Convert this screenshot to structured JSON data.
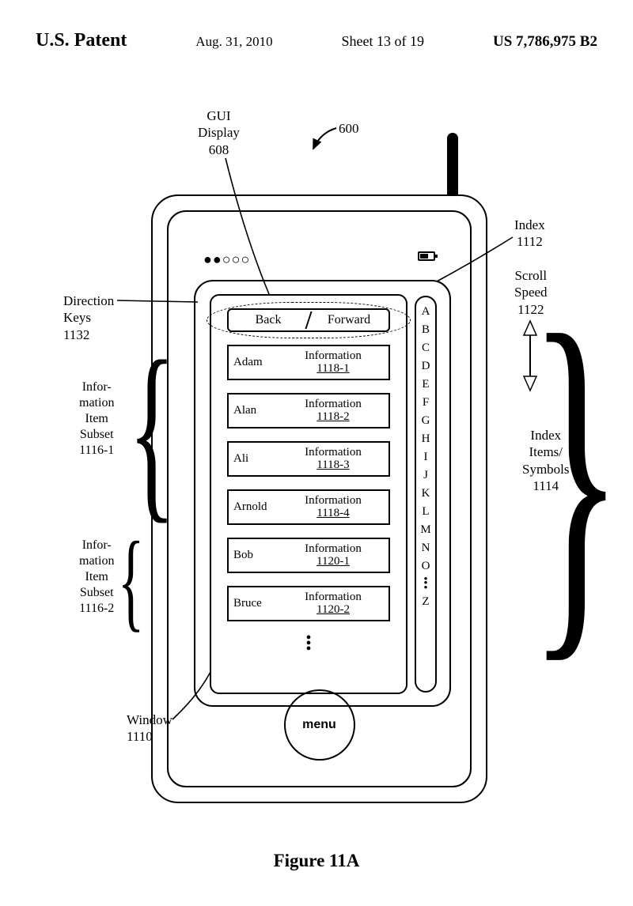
{
  "header": {
    "title": "U.S. Patent",
    "date": "Aug. 31, 2010",
    "sheet": "Sheet 13 of 19",
    "patno": "US 7,786,975 B2"
  },
  "labels": {
    "gui_display": "GUI\nDisplay\n608",
    "ref600": "600",
    "direction_keys": "Direction\nKeys\n1132",
    "index": "Index\n1112",
    "scroll_speed": "Scroll\nSpeed\n1122",
    "subset1": "Infor-\nmation\nItem\nSubset\n1116-1",
    "subset2": "Infor-\nmation\nItem\nSubset\n1116-2",
    "index_items": "Index\nItems/\nSymbols\n1114",
    "window": "Window\n1110",
    "figure": "Figure 11A"
  },
  "status": {
    "dots": "●●○○○"
  },
  "tabs": {
    "back": "Back",
    "forward": "Forward"
  },
  "items": [
    {
      "name": "Adam",
      "info": "Information",
      "ref": "1118-1"
    },
    {
      "name": "Alan",
      "info": "Information",
      "ref": "1118-2"
    },
    {
      "name": "Ali",
      "info": "Information",
      "ref": "1118-3"
    },
    {
      "name": "Arnold",
      "info": "Information",
      "ref": "1118-4"
    },
    {
      "name": "Bob",
      "info": "Information",
      "ref": "1120-1"
    },
    {
      "name": "Bruce",
      "info": "Information",
      "ref": "1120-2"
    }
  ],
  "index_letters": [
    "A",
    "B",
    "C",
    "D",
    "E",
    "F",
    "G",
    "H",
    "I",
    "J",
    "K",
    "L",
    "M",
    "N",
    "O"
  ],
  "index_tail": "Z",
  "menu": "menu"
}
